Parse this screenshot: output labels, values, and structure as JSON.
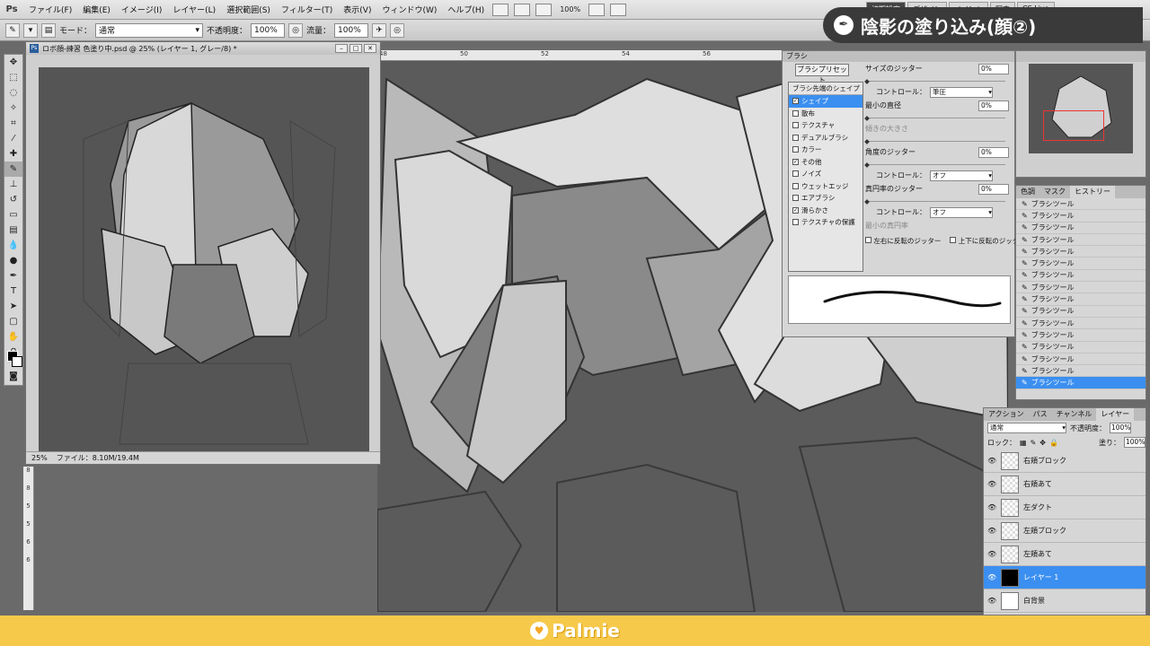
{
  "app": {
    "logo": "Ps"
  },
  "menu": {
    "items": [
      "ファイル(F)",
      "編集(E)",
      "イメージ(I)",
      "レイヤー(L)",
      "選択範囲(S)",
      "フィルター(T)",
      "表示(V)",
      "ウィンドウ(W)",
      "ヘルプ(H)"
    ],
    "zoom": "100%"
  },
  "workspace": {
    "tabs": [
      "初期設定",
      "デザイン",
      "ペイント",
      "写真",
      "CS Live"
    ],
    "active": 0
  },
  "options": {
    "mode_label": "モード：",
    "mode_value": "通常",
    "opacity_label": "不透明度：",
    "opacity_value": "100%",
    "flow_label": "流量：",
    "flow_value": "100%"
  },
  "banner": {
    "title": "陰影の塗り込み(顔②)"
  },
  "document": {
    "title": "ロボ顔-練習 色塗り中.psd @ 25% (レイヤー 1, グレー/8) *",
    "zoom": "25%",
    "file_info": "ファイル：8.10M/19.4M"
  },
  "brush": {
    "tab": "ブラシ",
    "preset_button": "ブラシプリセット",
    "shape_header": "ブラシ先端のシェイプ",
    "items": [
      {
        "label": "シェイプ",
        "checked": true,
        "selected": true
      },
      {
        "label": "散布",
        "checked": false
      },
      {
        "label": "テクスチャ",
        "checked": false
      },
      {
        "label": "デュアルブラシ",
        "checked": false
      },
      {
        "label": "カラー",
        "checked": false
      },
      {
        "label": "その他",
        "checked": true
      },
      {
        "label": "ノイズ",
        "checked": false
      },
      {
        "label": "ウェットエッジ",
        "checked": false
      },
      {
        "label": "エアブラシ",
        "checked": false
      },
      {
        "label": "滑らかさ",
        "checked": true
      },
      {
        "label": "テクスチャの保護",
        "checked": false
      }
    ],
    "size_jitter_label": "サイズのジッター",
    "size_jitter": "0%",
    "control_label": "コントロール：",
    "control_pressure": "筆圧",
    "min_diameter_label": "最小の直径",
    "min_diameter": "0%",
    "tilt_scale_label": "傾きの大きさ",
    "angle_jitter_label": "角度のジッター",
    "angle_jitter": "0%",
    "control_off": "オフ",
    "roundness_jitter_label": "真円率のジッター",
    "roundness_jitter": "0%",
    "min_roundness_label": "最小の真円率",
    "flip_x": "左右に反転のジッター",
    "flip_y": "上下に反転のジッター"
  },
  "history": {
    "tabs": [
      "色調",
      "マスク",
      "ヒストリー"
    ],
    "active": 2,
    "items": [
      "ブラシツール",
      "ブラシツール",
      "ブラシツール",
      "ブラシツール",
      "ブラシツール",
      "ブラシツール",
      "ブラシツール",
      "ブラシツール",
      "ブラシツール",
      "ブラシツール",
      "ブラシツール",
      "ブラシツール",
      "ブラシツール",
      "ブラシツール",
      "ブラシツール",
      "ブラシツール"
    ]
  },
  "layers": {
    "tabs": [
      "アクション",
      "パス",
      "チャンネル",
      "レイヤー"
    ],
    "active": 3,
    "blend": "通常",
    "opacity_label": "不透明度：",
    "opacity": "100%",
    "lock_label": "ロック：",
    "fill_label": "塗り：",
    "fill": "100%",
    "items": [
      {
        "name": "右頬ブロック",
        "thumb": "trans"
      },
      {
        "name": "右頬あて",
        "thumb": "trans"
      },
      {
        "name": "左ダクト",
        "thumb": "trans"
      },
      {
        "name": "左頬ブロック",
        "thumb": "trans"
      },
      {
        "name": "左頬あて",
        "thumb": "trans"
      },
      {
        "name": "レイヤー 1",
        "thumb": "black",
        "selected": true
      },
      {
        "name": "白背景",
        "thumb": "white"
      }
    ]
  },
  "footer": {
    "brand": "Palmie"
  }
}
